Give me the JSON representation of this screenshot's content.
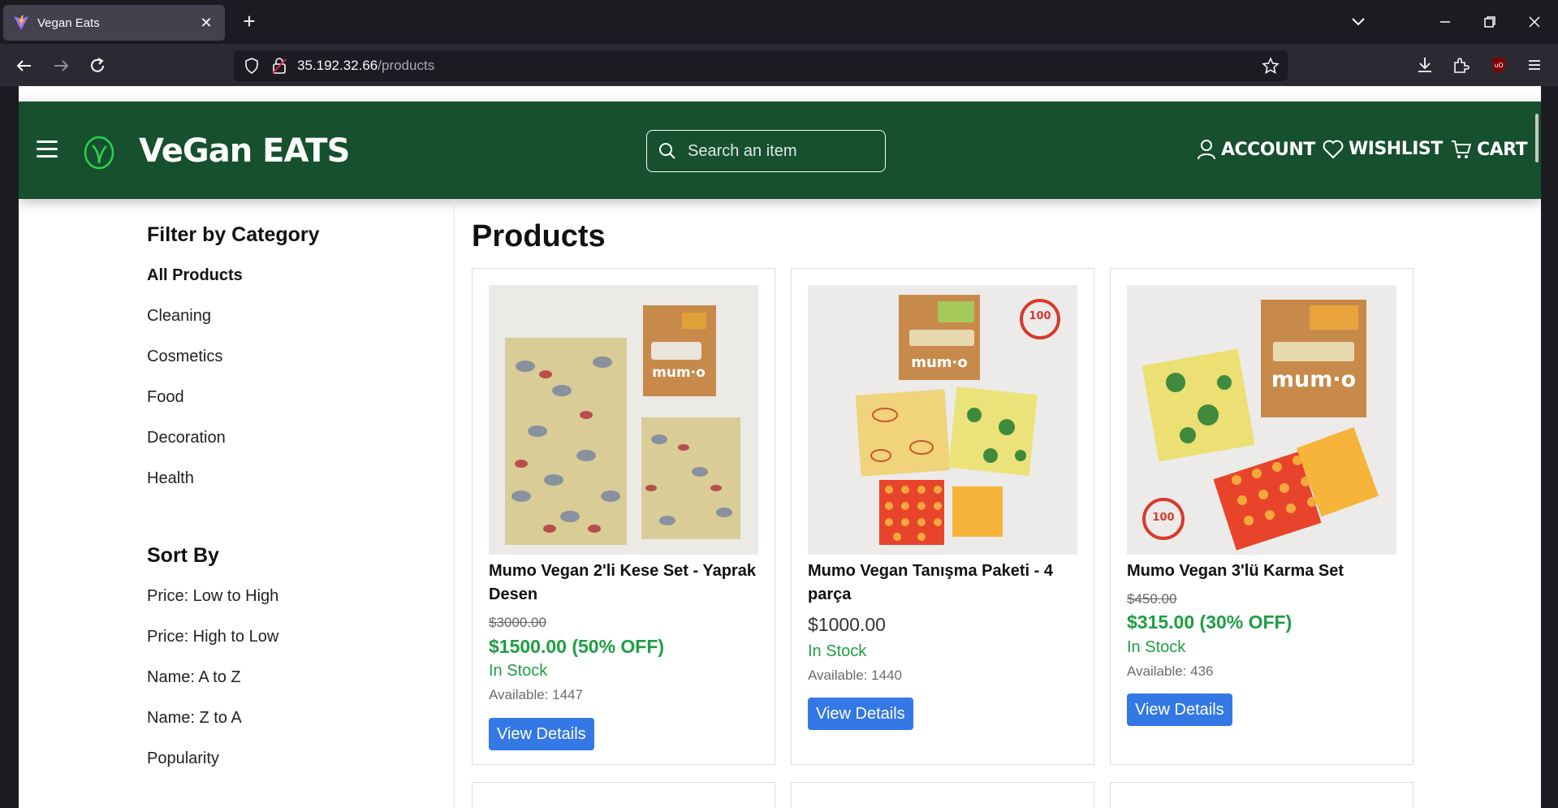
{
  "browser": {
    "tab_title": "Vegan Eats",
    "url_host": "35.192.32.66",
    "url_path": "/products"
  },
  "header": {
    "brand": "VeGan EATS",
    "search_placeholder": "Search an item",
    "account": "ACCOUNT",
    "wishlist": "WISHLIST",
    "cart": "CART"
  },
  "sidebar": {
    "filter_heading": "Filter by Category",
    "categories": [
      "All Products",
      "Cleaning",
      "Cosmetics",
      "Food",
      "Decoration",
      "Health"
    ],
    "sort_heading": "Sort By",
    "sort_options": [
      "Price: Low to High",
      "Price: High to Low",
      "Name: A to Z",
      "Name: Z to A",
      "Popularity"
    ]
  },
  "main": {
    "title": "Products",
    "products": [
      {
        "name": "Mumo Vegan 2'li Kese Set - Yaprak Desen",
        "old_price": "$3000.00",
        "sale_price": "$1500.00 (50% OFF)",
        "stock": "In Stock",
        "available": "Available: 1447",
        "button": "View Details"
      },
      {
        "name": "Mumo Vegan Tanışma Paketi - 4 parça",
        "price": "$1000.00",
        "stock": "In Stock",
        "available": "Available: 1440",
        "button": "View Details"
      },
      {
        "name": "Mumo Vegan 3'lü Karma Set",
        "old_price": "$450.00",
        "sale_price": "$315.00 (30% OFF)",
        "stock": "In Stock",
        "available": "Available: 436",
        "button": "View Details"
      }
    ]
  },
  "colors": {
    "header_bg": "#16502f",
    "sale_green": "#1e9e43",
    "button_blue": "#3478e5"
  }
}
